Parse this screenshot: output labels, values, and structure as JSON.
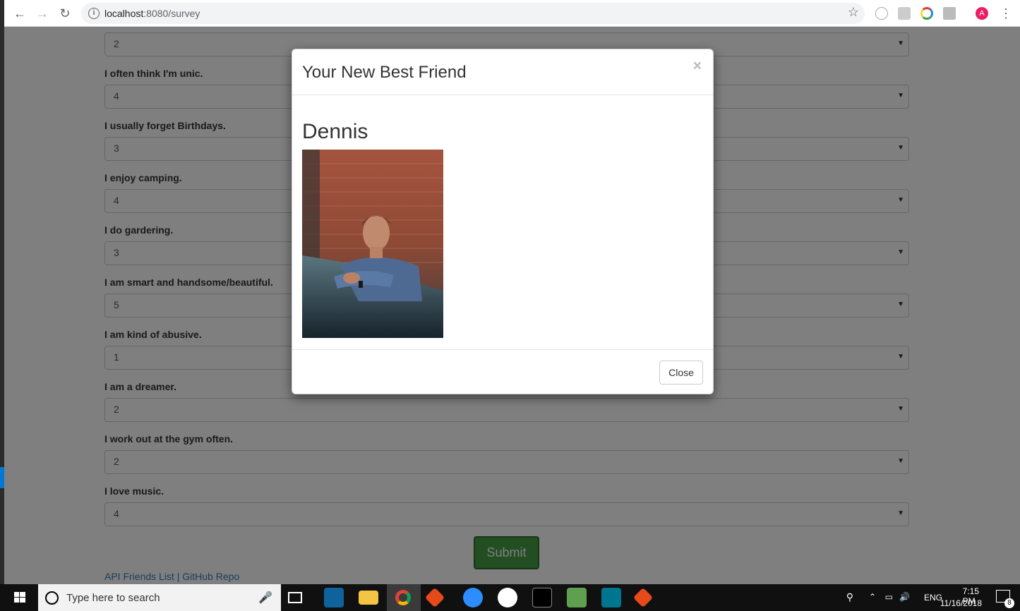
{
  "browser": {
    "url_host": "localhost",
    "url_path": ":8080/survey"
  },
  "survey": {
    "first_select_value": "2",
    "questions": [
      {
        "label": "I often think I'm unic.",
        "value": "4"
      },
      {
        "label": "I usually forget Birthdays.",
        "value": "3"
      },
      {
        "label": "I enjoy camping.",
        "value": "4"
      },
      {
        "label": "I do gardering.",
        "value": "3"
      },
      {
        "label": "I am smart and handsome/beautiful.",
        "value": "5"
      },
      {
        "label": "I am kind of abusive.",
        "value": "1"
      },
      {
        "label": "I am a dreamer.",
        "value": "2"
      },
      {
        "label": "I work out at the gym often.",
        "value": "2"
      },
      {
        "label": "I love music.",
        "value": "4"
      }
    ],
    "submit_label": "Submit",
    "footer_link_1": "API Friends List",
    "footer_sep": " | ",
    "footer_link_2": "GitHub Repo"
  },
  "modal": {
    "title": "Your New Best Friend",
    "close_x": "×",
    "friend_name": "Dennis",
    "close_label": "Close"
  },
  "taskbar": {
    "search_placeholder": "Type here to search",
    "lang": "ENG",
    "time": "7:15 PM",
    "date": "11/16/2018",
    "notif_count": "8"
  },
  "profile_initial": "A"
}
